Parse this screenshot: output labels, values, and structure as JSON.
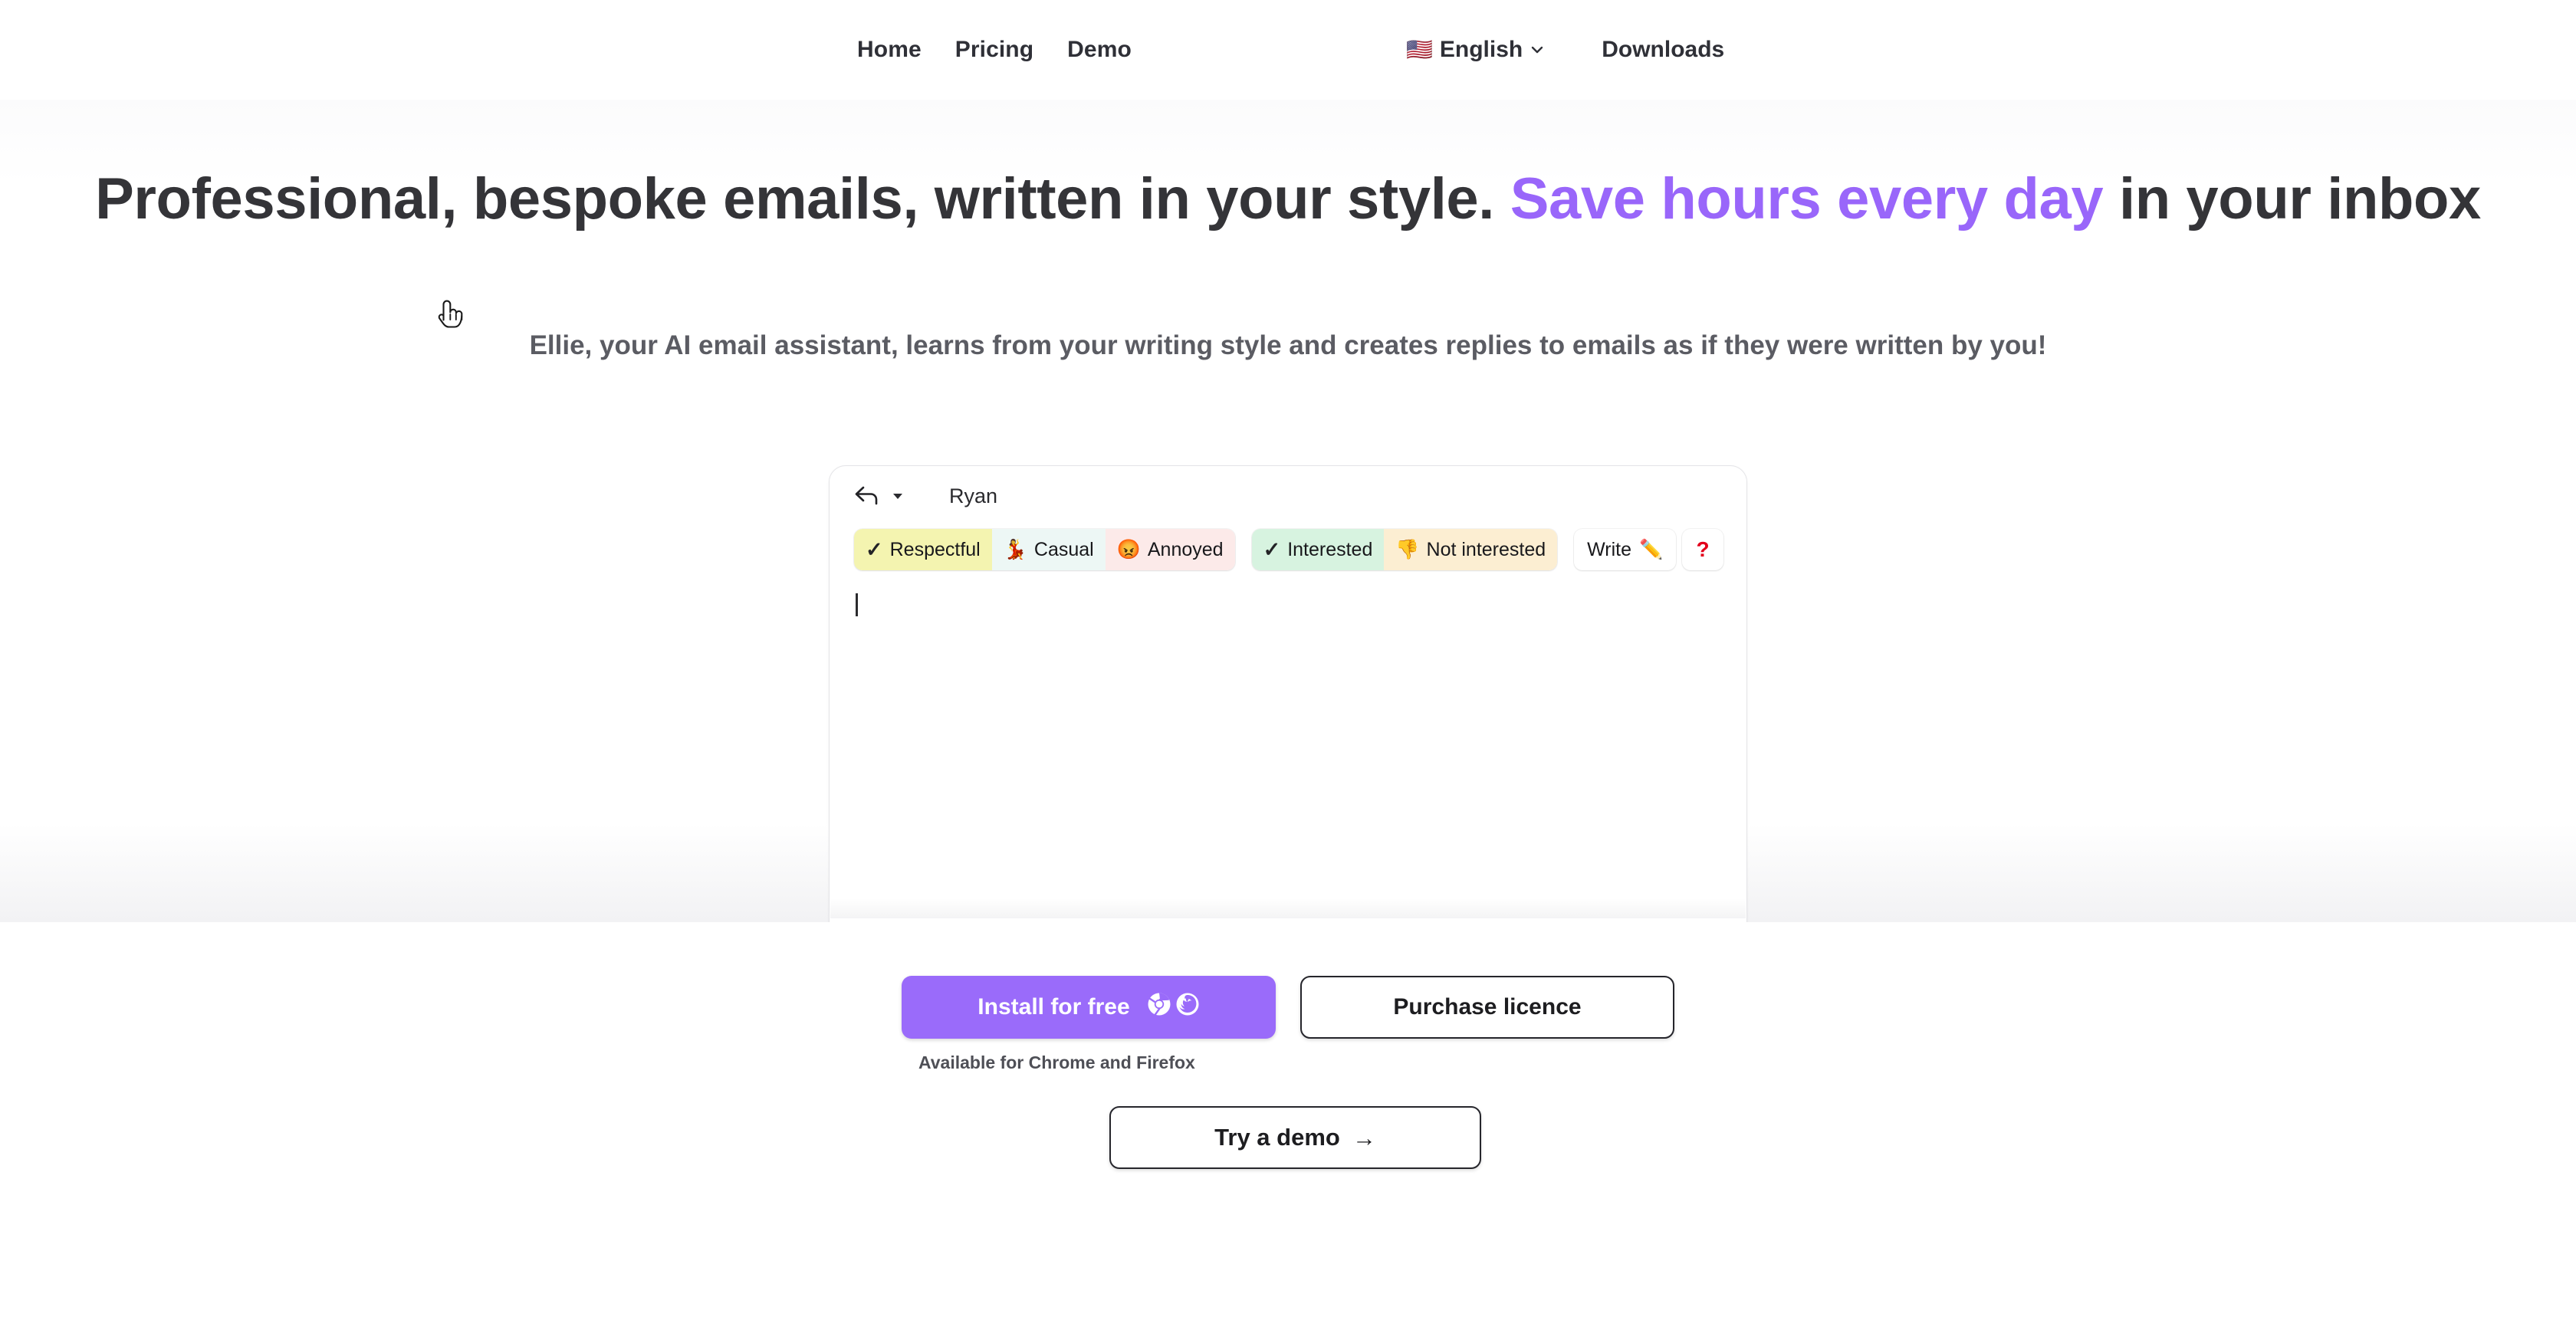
{
  "header": {
    "nav_links": [
      {
        "label": "Home",
        "name": "nav-link-home"
      },
      {
        "label": "Pricing",
        "name": "nav-link-pricing"
      },
      {
        "label": "Demo",
        "name": "nav-link-demo"
      }
    ],
    "language": {
      "flag": "🇺🇸",
      "label": "English",
      "chevron": "chevron-down-icon"
    },
    "downloads_label": "Downloads"
  },
  "hero": {
    "headline_part1": "Professional, bespoke emails, written in your style. ",
    "headline_accent": "Save hours every day",
    "headline_part2": " in your inbox",
    "subtitle": "Ellie, your AI email assistant, learns from your writing style and creates replies to emails as if they were written by you!",
    "accent_color": "#9966fa"
  },
  "composer": {
    "reply_icon": "reply-arrow-icon",
    "reply_caret": "caret-down-icon",
    "recipient": "Ryan",
    "tone_group_1": [
      {
        "emoji": "✓",
        "label": "Respectful",
        "bg": "#f4f4b0",
        "is_check": true
      },
      {
        "emoji": "💃",
        "label": "Casual",
        "bg": "#edf7f5",
        "is_check": false
      },
      {
        "emoji": "😡",
        "label": "Annoyed",
        "bg": "#fceae9",
        "is_check": false
      }
    ],
    "tone_group_2": [
      {
        "emoji": "✓",
        "label": "Interested",
        "bg": "#d7f3e0",
        "is_check": true
      },
      {
        "emoji": "👎",
        "label": "Not interested",
        "bg": "#fceed2",
        "is_check": false
      }
    ],
    "write_button": {
      "label": "Write",
      "emoji": "✏️"
    },
    "help_button": {
      "label": "?",
      "color": "#e3001b"
    },
    "body_text": ""
  },
  "cta": {
    "install_label": "Install for free",
    "install_bg": "#9a6bfa",
    "browser_icons": [
      "chrome-icon",
      "firefox-icon"
    ],
    "purchase_label": "Purchase licence",
    "available_note": "Available for Chrome and Firefox",
    "demo_label": "Try a demo",
    "demo_arrow": "→"
  },
  "cursor": {
    "type": "pointer-hand-cursor"
  }
}
